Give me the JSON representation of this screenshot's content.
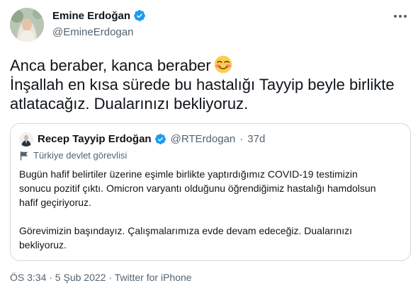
{
  "author": {
    "display_name": "Emine Erdoğan",
    "handle": "@EmineErdogan"
  },
  "icons": {
    "verified": "verified-badge-icon",
    "more": "more-options-icon",
    "emoji": "smiling-face-emoji-icon",
    "label": "flag-icon"
  },
  "colors": {
    "verified_blue": "#1d9bf0",
    "secondary_text": "#536471",
    "border": "#cfd9de"
  },
  "tweet": {
    "lines": [
      "Anca beraber, kanca beraber",
      "İnşallah en kısa sürede bu hastalığı Tayyip beyle birlikte",
      "atlatacağız. Dualarınızı bekliyoruz."
    ]
  },
  "quote": {
    "display_name": "Recep Tayyip Erdoğan",
    "handle": "@RTErdogan",
    "separator": "·",
    "time": "37d",
    "label": "Türkiye devlet görevlisi",
    "paragraph1": [
      "Bugün hafif belirtiler üzerine eşimle birlikte yaptırdığımız COVID-19 testimizin",
      "sonucu pozitif çıktı. Omicron varyantı olduğunu öğrendiğimiz hastalığı hamdolsun",
      "hafif geçiriyoruz."
    ],
    "paragraph2": [
      "Görevimizin başındayız. Çalışmalarımıza evde devam edeceğiz. Dualarınızı",
      "bekliyoruz."
    ]
  },
  "meta": {
    "text": "ÖS 3:34 · 5 Şub 2022 · Twitter for iPhone"
  }
}
